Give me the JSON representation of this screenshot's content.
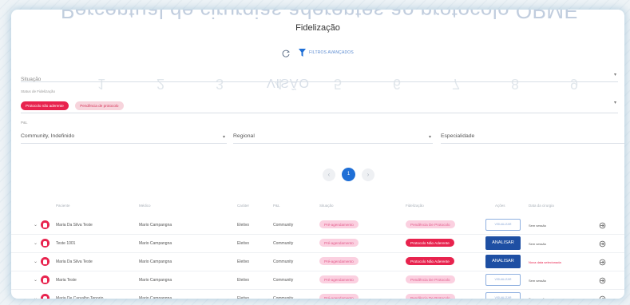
{
  "background_title": "Percentual de cirurgias aderentes ao protocolo OPME",
  "background_subtitle": "VISÃO",
  "background_numbers": [
    "1",
    "2",
    "3",
    "4",
    "5",
    "6",
    "7",
    "8",
    "9"
  ],
  "page_title": "Fidelização",
  "toolbar": {
    "refresh_icon": "refresh-icon",
    "filter_icon": "filter-icon",
    "filter_label": "FILTROS AVANÇADOS"
  },
  "filters": {
    "situacao": {
      "label": "Situação"
    },
    "status": {
      "label": "Status de Fidelização",
      "chips": [
        "Protocolo não aderente",
        "Pendência de protocolo"
      ]
    },
    "pal": {
      "label": "P&L",
      "value": "Community, Indefinido"
    },
    "regional": {
      "label": "Regional"
    },
    "especialidade": {
      "label": "Especialidade"
    }
  },
  "pagination": {
    "current_page": "1",
    "prev": "‹",
    "next": "›"
  },
  "table": {
    "columns": [
      "Paciente",
      "Médico",
      "Caráter",
      "P&L",
      "Situação",
      "Fidelização",
      "Ações",
      "Data da cirurgia"
    ],
    "rows": [
      {
        "paciente": "Maria Da Silva Teste",
        "medico": "Mario Campangna",
        "carater": "Eletivo",
        "pal": "Community",
        "situacao": "Pré-agendamento",
        "fidelizacao": "Pendência De Protocolo",
        "fid_style": "soft",
        "acao": "VISUALIZAR",
        "acao_style": "outline",
        "data": "Sem sessão",
        "data_style": "normal"
      },
      {
        "paciente": "Teste 1001",
        "medico": "Mario Campangna",
        "carater": "Eletivo",
        "pal": "Community",
        "situacao": "Pré-agendamento",
        "fidelizacao": "Protocolo Não Aderente",
        "fid_style": "strong",
        "acao": "ANALISAR",
        "acao_style": "solid",
        "data": "Sem sessão",
        "data_style": "normal"
      },
      {
        "paciente": "Maria Da Silva Teste",
        "medico": "Mario Campangna",
        "carater": "Eletivo",
        "pal": "Community",
        "situacao": "Pré-agendamento",
        "fidelizacao": "Protocolo Não Aderente",
        "fid_style": "strong",
        "acao": "ANALISAR",
        "acao_style": "solid",
        "data": "Nova data selecionada",
        "data_style": "red"
      },
      {
        "paciente": "Maria Teste",
        "medico": "Mario Campangna",
        "carater": "Eletivo",
        "pal": "Community",
        "situacao": "Pré-agendamento",
        "fidelizacao": "Pendência De Protocolo",
        "fid_style": "soft",
        "acao": "VISUALIZAR",
        "acao_style": "outline",
        "data": "Sem sessão",
        "data_style": "normal"
      },
      {
        "paciente": "Maria De Carvalho Tenorio",
        "medico": "Mario Campangna",
        "carater": "Eletivo",
        "pal": "Community",
        "situacao": "Pré-agendamento",
        "fidelizacao": "Pendência De Protocolo",
        "fid_style": "soft",
        "acao": "VISUALIZAR",
        "acao_style": "outline",
        "data": "Sem sessão",
        "data_style": "normal"
      }
    ]
  },
  "colors": {
    "accent_red": "#e8234e",
    "accent_blue": "#1e4fa3",
    "pagination_blue": "#1f6fd6",
    "soft_pink": "#fbd0e0"
  }
}
